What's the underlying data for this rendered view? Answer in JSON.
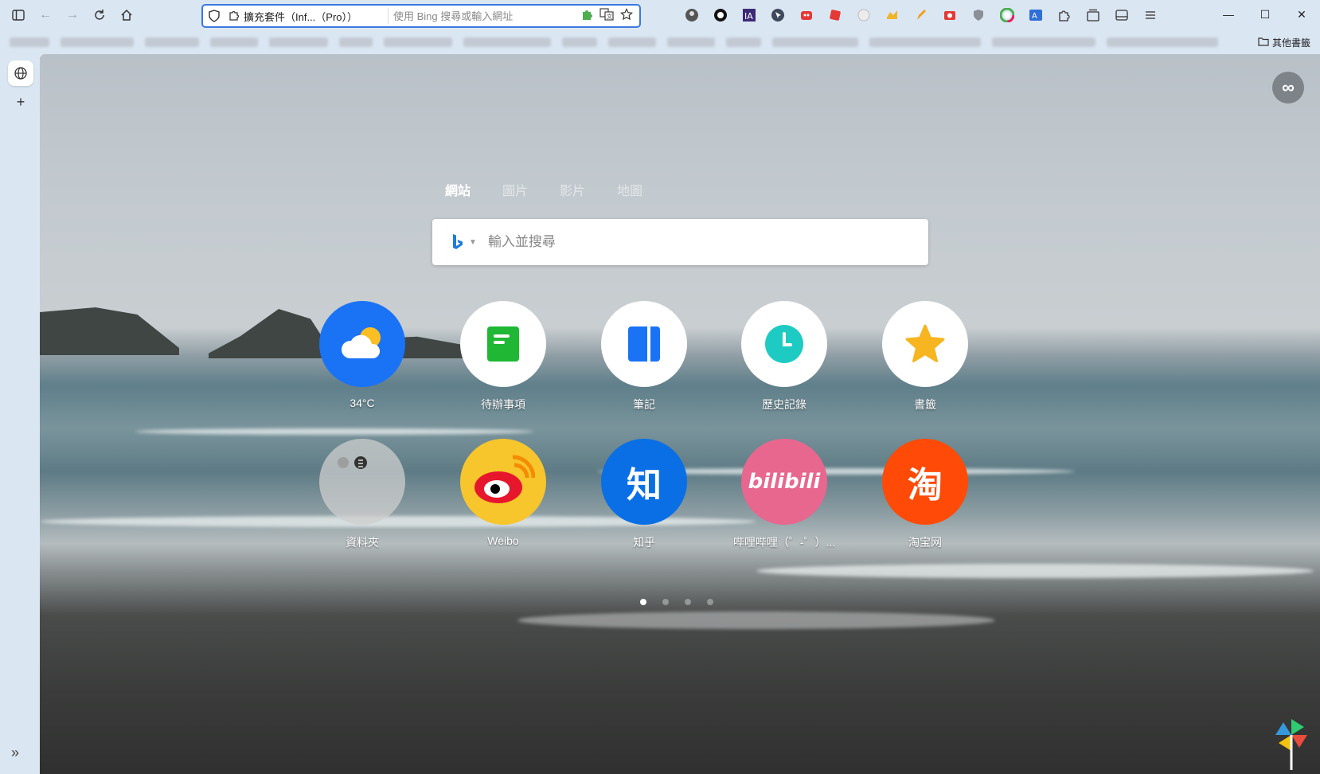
{
  "toolbar": {
    "tab_title": "擴充套件（Inf...（Pro））",
    "address_placeholder": "使用 Bing 搜尋或輸入網址"
  },
  "bookmarks": {
    "other_label": "其他書籤"
  },
  "search": {
    "tabs": [
      "網站",
      "圖片",
      "影片",
      "地圖"
    ],
    "active_tab": "網站",
    "placeholder": "輸入並搜尋",
    "engine": "Bing"
  },
  "tiles": [
    {
      "label": "34°C",
      "icon": "weather-icon",
      "color": "#1a73f5"
    },
    {
      "label": "待辦事項",
      "icon": "todo-icon",
      "color": "#ffffff"
    },
    {
      "label": "筆記",
      "icon": "notes-icon",
      "color": "#ffffff"
    },
    {
      "label": "歷史記錄",
      "icon": "history-icon",
      "color": "#ffffff"
    },
    {
      "label": "書籤",
      "icon": "bookmark-star-icon",
      "color": "#ffffff"
    },
    {
      "label": "資料夾",
      "icon": "folder-icon",
      "color": "rgba(200,200,200,0.7)"
    },
    {
      "label": "Weibo",
      "icon": "weibo-icon",
      "color": "#f7c52c"
    },
    {
      "label": "知乎",
      "icon": "zhihu-icon",
      "color": "#0a6fe4"
    },
    {
      "label": "哔哩哔哩（゜-゜）...",
      "icon": "bilibili-icon",
      "color": "#e7678f"
    },
    {
      "label": "淘宝网",
      "icon": "taobao-icon",
      "color": "#ff4a08"
    }
  ],
  "pagination": {
    "pages": 4,
    "current": 1
  },
  "colors": {
    "accent": "#3b7ae0",
    "chrome": "#dbe6f3"
  }
}
